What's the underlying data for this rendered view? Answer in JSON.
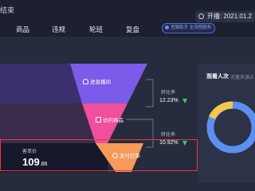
{
  "header": {
    "brand_fragment": "结束",
    "time_label": "开播",
    "time_value": "2021.01.2",
    "tabs": [
      "商品",
      "违规",
      "轮班",
      "复盘"
    ],
    "pill_text": "官服助手 全流程服务"
  },
  "funnel": {
    "stages": [
      {
        "label": "进直播间",
        "color": "#7b5be9"
      },
      {
        "label": "访问商品",
        "color": "#ef4f9c"
      },
      {
        "label": "支付订单",
        "color": "#f79a5a"
      }
    ],
    "conversions": [
      {
        "label": "转化率",
        "value": "12.23%",
        "direction": "down"
      },
      {
        "label": "转化率",
        "value": "10.92%",
        "direction": "down"
      }
    ],
    "price_label": "客单价",
    "price_int": "109",
    "price_dec": ".86"
  },
  "right_panel": {
    "title": "观看人次",
    "subtitle": "流量来源占",
    "donut_colors": [
      "#5b8ff0",
      "#f2c94c"
    ]
  },
  "colors": {
    "highlight_border": "#e63b3b",
    "down_indicator": "#2fd06e"
  }
}
